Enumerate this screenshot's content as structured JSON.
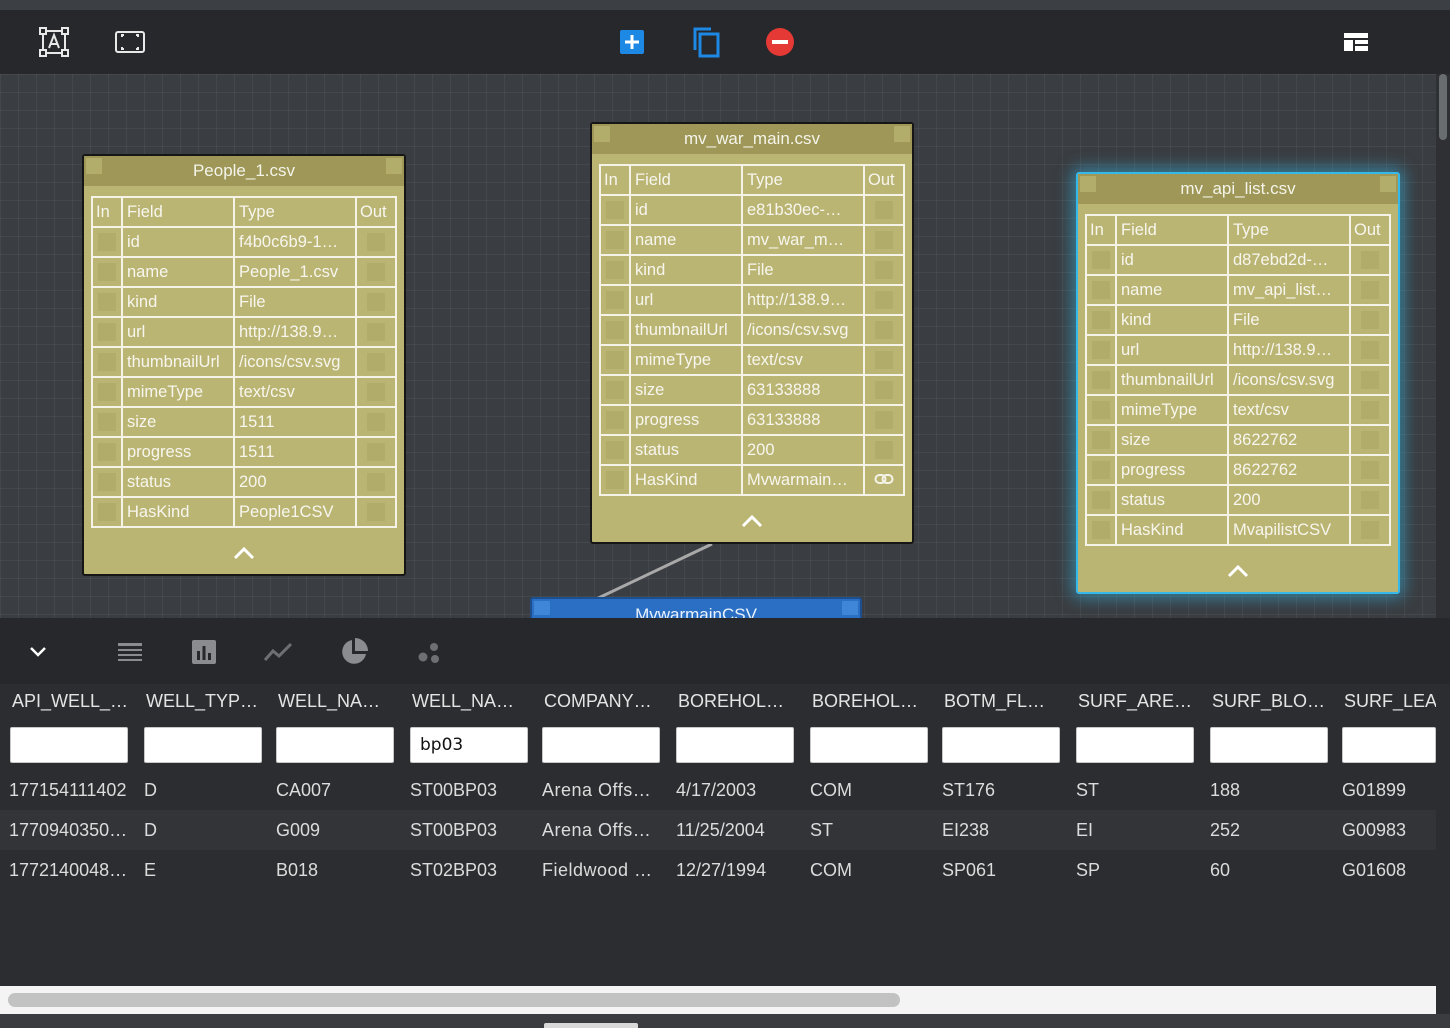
{
  "toolbar": {
    "icons": [
      "text-frame-icon",
      "fit-view-icon",
      "add-icon",
      "copy-icon",
      "remove-icon",
      "layout-icon"
    ],
    "colors": {
      "add": "#1e88e5",
      "copy": "#1e88e5",
      "remove": "#e53935"
    }
  },
  "nodes": [
    {
      "title": "People_1.csv",
      "headers": {
        "in": "In",
        "field": "Field",
        "type": "Type",
        "out": "Out"
      },
      "rows": [
        {
          "field": "id",
          "type": "f4b0c6b9-1…"
        },
        {
          "field": "name",
          "type": "People_1.csv"
        },
        {
          "field": "kind",
          "type": "File"
        },
        {
          "field": "url",
          "type": "http://138.9…"
        },
        {
          "field": "thumbnailUrl",
          "type": "/icons/csv.svg"
        },
        {
          "field": "mimeType",
          "type": "text/csv"
        },
        {
          "field": "size",
          "type": "1511"
        },
        {
          "field": "progress",
          "type": "1511"
        },
        {
          "field": "status",
          "type": "200"
        },
        {
          "field": "HasKind",
          "type": "People1CSV"
        }
      ]
    },
    {
      "title": "mv_war_main.csv",
      "headers": {
        "in": "In",
        "field": "Field",
        "type": "Type",
        "out": "Out"
      },
      "rows": [
        {
          "field": "id",
          "type": "e81b30ec-…"
        },
        {
          "field": "name",
          "type": "mv_war_m…"
        },
        {
          "field": "kind",
          "type": "File"
        },
        {
          "field": "url",
          "type": "http://138.9…"
        },
        {
          "field": "thumbnailUrl",
          "type": "/icons/csv.svg"
        },
        {
          "field": "mimeType",
          "type": "text/csv"
        },
        {
          "field": "size",
          "type": "63133888"
        },
        {
          "field": "progress",
          "type": "63133888"
        },
        {
          "field": "status",
          "type": "200"
        },
        {
          "field": "HasKind",
          "type": "Mvwarmain…"
        }
      ]
    },
    {
      "title": "mv_api_list.csv",
      "headers": {
        "in": "In",
        "field": "Field",
        "type": "Type",
        "out": "Out"
      },
      "rows": [
        {
          "field": "id",
          "type": "d87ebd2d-…"
        },
        {
          "field": "name",
          "type": "mv_api_list…"
        },
        {
          "field": "kind",
          "type": "File"
        },
        {
          "field": "url",
          "type": "http://138.9…"
        },
        {
          "field": "thumbnailUrl",
          "type": "/icons/csv.svg"
        },
        {
          "field": "mimeType",
          "type": "text/csv"
        },
        {
          "field": "size",
          "type": "8622762"
        },
        {
          "field": "progress",
          "type": "8622762"
        },
        {
          "field": "status",
          "type": "200"
        },
        {
          "field": "HasKind",
          "type": "MvapilistCSV"
        }
      ]
    }
  ],
  "linked_node": {
    "title": "MvwarmainCSV"
  },
  "panel": {
    "icons": [
      "collapse-chevron-icon",
      "table-view-icon",
      "bar-chart-icon",
      "line-chart-icon",
      "pie-chart-icon",
      "scatter-chart-icon"
    ]
  },
  "grid": {
    "columns": [
      "API_WELL_…",
      "WELL_TYP…",
      "WELL_NA…",
      "WELL_NA…",
      "COMPANY…",
      "BOREHOL…",
      "BOREHOL…",
      "BOTM_FL…",
      "SURF_ARE…",
      "SURF_BLO…",
      "SURF_LEA"
    ],
    "filters": [
      "",
      "",
      "",
      "bp03",
      "",
      "",
      "",
      "",
      "",
      "",
      ""
    ],
    "rows": [
      [
        "177154111402",
        "D",
        "CA007",
        "ST00BP03",
        "Arena Offs…",
        "4/17/2003",
        "COM",
        "ST176",
        "ST",
        "188",
        "G01899"
      ],
      [
        "1770940350…",
        "D",
        "G009",
        "ST00BP03",
        "Arena Offs…",
        "11/25/2004",
        "ST",
        "EI238",
        "EI",
        "252",
        "G00983"
      ],
      [
        "1772140048…",
        "E",
        "B018",
        "ST02BP03",
        "Fieldwood …",
        "12/27/1994",
        "COM",
        "SP061",
        "SP",
        "60",
        "G01608"
      ]
    ]
  }
}
